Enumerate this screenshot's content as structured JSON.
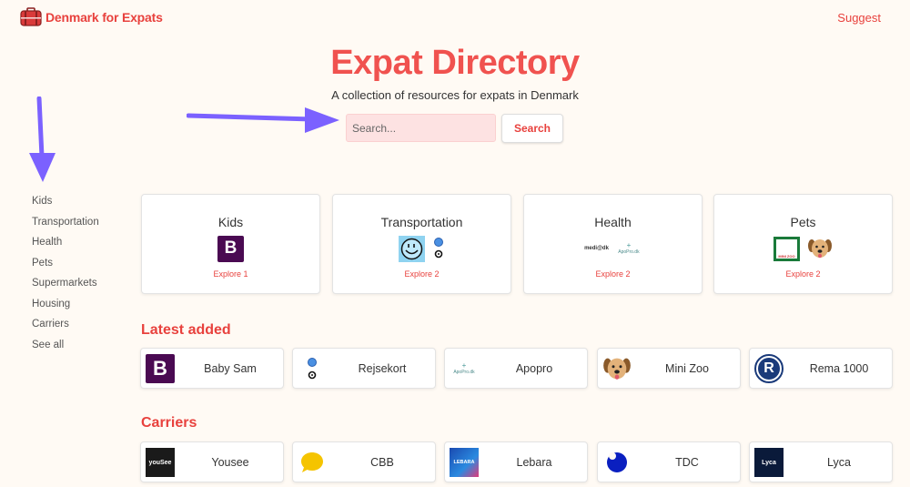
{
  "header": {
    "brand": "Denmark for Expats",
    "suggest": "Suggest"
  },
  "hero": {
    "title": "Expat Directory",
    "subtitle": "A collection of resources for expats in Denmark",
    "search_placeholder": "Search...",
    "search_button": "Search"
  },
  "sidebar": {
    "items": [
      "Kids",
      "Transportation",
      "Health",
      "Pets",
      "Supermarkets",
      "Housing",
      "Carriers",
      "See all"
    ]
  },
  "categories": [
    {
      "title": "Kids",
      "explore": "Explore 1"
    },
    {
      "title": "Transportation",
      "explore": "Explore 2"
    },
    {
      "title": "Health",
      "explore": "Explore 2",
      "logo1": "medi@dk",
      "logo2": "ApoPro.dk"
    },
    {
      "title": "Pets",
      "explore": "Explore 2",
      "logo1": "MINI ZOO"
    }
  ],
  "latest": {
    "title": "Latest added",
    "items": [
      {
        "label": "Baby Sam"
      },
      {
        "label": "Rejsekort"
      },
      {
        "label": "Apopro",
        "logo": "ApoPro.dk"
      },
      {
        "label": "Mini Zoo"
      },
      {
        "label": "Rema 1000"
      }
    ]
  },
  "carriers": {
    "title": "Carriers",
    "items": [
      {
        "label": "Yousee",
        "logo": "youSee"
      },
      {
        "label": "CBB"
      },
      {
        "label": "Lebara",
        "logo": "LEBARA"
      },
      {
        "label": "TDC"
      },
      {
        "label": "Lyca",
        "logo": "Lyca"
      }
    ]
  },
  "logo_glyphs": {
    "baby_sam": "B",
    "rema": "R"
  },
  "colors": {
    "accent": "#e8413d",
    "arrow": "#7b61ff",
    "baby_sam": "#4a0a52"
  }
}
